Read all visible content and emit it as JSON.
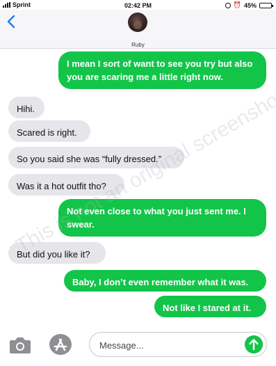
{
  "status_bar": {
    "carrier": "Sprint",
    "time": "02:42 PM",
    "battery": "45%",
    "battery_level": 0.45
  },
  "header": {
    "contact_name": "Ruby",
    "back_icon": "chevron-left-icon"
  },
  "messages": [
    {
      "direction": "outgoing",
      "text": "I mean I sort of want to see you try but also you are scaring me a little right now."
    },
    {
      "direction": "incoming",
      "text": "Hihi."
    },
    {
      "direction": "incoming",
      "text": "Scared is right."
    },
    {
      "direction": "incoming",
      "text": "So you said she was “fully dressed.”"
    },
    {
      "direction": "incoming",
      "text": "Was it a hot outfit tho?"
    },
    {
      "direction": "outgoing",
      "text": "Not even close to what you just sent me. I swear."
    },
    {
      "direction": "incoming",
      "text": "But did you like it?"
    },
    {
      "direction": "outgoing",
      "text": "Baby, I don’t even remember what it was."
    },
    {
      "direction": "outgoing",
      "text": "Not like I stared at it."
    }
  ],
  "watermark": "This is not an original screenshot",
  "composer": {
    "placeholder": "Message...",
    "camera_icon": "camera-icon",
    "apps_icon": "app-store-icon",
    "send_icon": "send-arrow-icon"
  },
  "colors": {
    "outgoing_bubble": "#12c549",
    "incoming_bubble": "#e5e5ea",
    "accent_blue": "#1b7bf5"
  }
}
